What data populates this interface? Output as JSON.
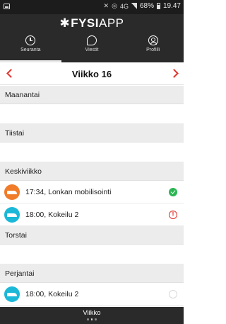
{
  "status_bar": {
    "battery_percent": "68%",
    "time": "19.47",
    "network": "4G"
  },
  "app": {
    "logo_fysi": "FYSI",
    "logo_app": "APP"
  },
  "tabs": [
    {
      "label": "Seuranta",
      "icon": "clock-icon",
      "active": true
    },
    {
      "label": "Viestit",
      "icon": "chat-bubble-icon",
      "active": false
    },
    {
      "label": "Profiili",
      "icon": "profile-icon",
      "active": false
    }
  ],
  "week": {
    "title": "Viikko 16"
  },
  "days": [
    {
      "name": "Maanantai",
      "entries": []
    },
    {
      "name": "Tiistai",
      "entries": []
    },
    {
      "name": "Keskiviikko",
      "entries": [
        {
          "text": "17:34, Lonkan mobilisointi",
          "avatar_color": "#f07c2a",
          "status": "done"
        },
        {
          "text": "18:00, Kokeilu 2",
          "avatar_color": "#1bb8d8",
          "status": "warning"
        }
      ]
    },
    {
      "name": "Torstai",
      "entries": []
    },
    {
      "name": "Perjantai",
      "entries": [
        {
          "text": "18:00, Kokeilu 2",
          "avatar_color": "#1bb8d8",
          "status": "empty"
        }
      ]
    }
  ],
  "bottom": {
    "label": "Viikko"
  },
  "colors": {
    "accent": "#e0312b",
    "done": "#2bb552",
    "dark_bar": "#2a2a2a"
  }
}
